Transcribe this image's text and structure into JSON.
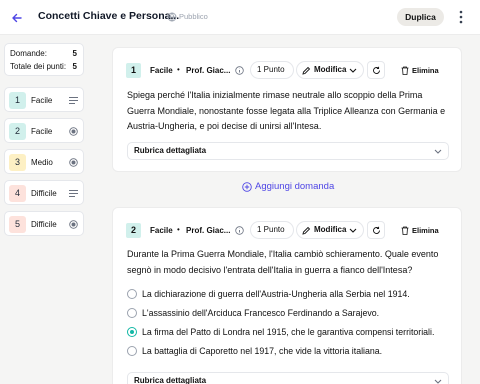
{
  "header": {
    "title": "Concetti Chiave e Persona...",
    "visibility": "Pubblico",
    "duplicate_label": "Duplica"
  },
  "summary": {
    "questions_label": "Domande:",
    "questions_value": "5",
    "points_label": "Totale dei punti:",
    "points_value": "5"
  },
  "nav": [
    {
      "num": "1",
      "label": "Facile",
      "type_icon": "lines-icon",
      "color": "#d1f0ec"
    },
    {
      "num": "2",
      "label": "Facile",
      "type_icon": "radio-icon",
      "color": "#d1f0ec"
    },
    {
      "num": "3",
      "label": "Medio",
      "type_icon": "radio-icon",
      "color": "#fdf0c4"
    },
    {
      "num": "4",
      "label": "Difficile",
      "type_icon": "lines-icon",
      "color": "#fde2dc"
    },
    {
      "num": "5",
      "label": "Difficile",
      "type_icon": "radio-icon",
      "color": "#fde2dc"
    }
  ],
  "questions": [
    {
      "num": "1",
      "difficulty": "Facile",
      "author": "Prof. Giac...",
      "points": "1 Punto",
      "edit_label": "Modifica",
      "delete_label": "Elimina",
      "text": "Spiega perché l'Italia inizialmente rimase neutrale allo scoppio della Prima Guerra Mondiale, nonostante fosse legata alla Triplice Alleanza con Germania e Austria-Ungheria, e poi decise di unirsi all'Intesa.",
      "rubric": "Rubrica dettagliata"
    },
    {
      "num": "2",
      "difficulty": "Facile",
      "author": "Prof. Giac...",
      "points": "1 Punto",
      "edit_label": "Modifica",
      "delete_label": "Elimina",
      "text": "Durante la Prima Guerra Mondiale, l'Italia cambiò schieramento. Quale evento segnò in modo decisivo l'entrata dell'Italia in guerra a fianco dell'Intesa?",
      "options": [
        {
          "text": "La dichiarazione di guerra dell'Austria-Ungheria alla Serbia nel 1914.",
          "selected": false
        },
        {
          "text": "L'assassinio dell'Arciduca Francesco Ferdinando a Sarajevo.",
          "selected": false
        },
        {
          "text": "La firma del Patto di Londra nel 1915, che le garantiva compensi territoriali.",
          "selected": true
        },
        {
          "text": "La battaglia di Caporetto nel 1917, che vide la vittoria italiana.",
          "selected": false
        }
      ],
      "rubric": "Rubrica dettagliata"
    }
  ],
  "add_question_label": "Aggiungi domanda",
  "colors": {
    "accent": "#4f46e5",
    "selected": "#14b8a6",
    "easy": "#d1f0ec",
    "medium": "#fdf0c4",
    "hard": "#fde2dc"
  }
}
